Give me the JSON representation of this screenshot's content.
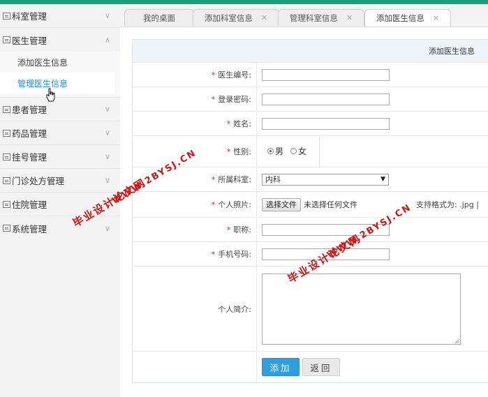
{
  "sidebar": {
    "items": [
      {
        "label": "科室管理",
        "icon": "folder-icon",
        "chevron": "chevron-down-icon"
      },
      {
        "label": "医生管理",
        "icon": "folder-icon",
        "chevron": "chevron-up-icon",
        "children": [
          {
            "label": "添加医生信息"
          },
          {
            "label": "管理医生信息"
          }
        ]
      },
      {
        "label": "患者管理",
        "icon": "folder-icon",
        "chevron": "chevron-down-icon"
      },
      {
        "label": "药品管理",
        "icon": "folder-icon",
        "chevron": "chevron-down-icon"
      },
      {
        "label": "挂号管理",
        "icon": "folder-icon",
        "chevron": "chevron-down-icon"
      },
      {
        "label": "门诊处方管理",
        "icon": "folder-icon",
        "chevron": "chevron-down-icon"
      },
      {
        "label": "住院管理",
        "icon": "folder-icon",
        "chevron": "chevron-down-icon"
      },
      {
        "label": "系统管理",
        "icon": "folder-icon",
        "chevron": "chevron-down-icon"
      }
    ]
  },
  "tabs": [
    {
      "label": "我的桌面",
      "closable": false
    },
    {
      "label": "添加科室信息",
      "closable": true
    },
    {
      "label": "管理科室信息",
      "closable": true
    },
    {
      "label": "添加医生信息",
      "closable": true,
      "active": true
    }
  ],
  "form": {
    "title": "添加医生信息",
    "fields": {
      "doctor_id": {
        "label": "医生编号:",
        "required": "*",
        "value": ""
      },
      "password": {
        "label": "登录密码:",
        "required": "*",
        "value": ""
      },
      "name": {
        "label": "姓名:",
        "required": "*",
        "value": ""
      },
      "gender": {
        "label": "性别:",
        "required": "*",
        "options": [
          "男",
          "女"
        ],
        "selected": "男"
      },
      "department": {
        "label": "所属科室:",
        "required": "*",
        "selected": "内科"
      },
      "photo": {
        "label": "个人照片:",
        "required": "*",
        "button": "选择文件",
        "status": "未选择任何文件",
        "hint": "支持格式为: .jpg |"
      },
      "title": {
        "label": "职称:",
        "required": "*",
        "value": ""
      },
      "phone": {
        "label": "手机号码:",
        "required": "*",
        "value": ""
      },
      "bio": {
        "label": "个人简介:",
        "value": ""
      }
    },
    "buttons": {
      "submit": "添加",
      "back": "返回"
    }
  },
  "watermark": {
    "line1": "毕业设计论文网",
    "line2": "WWW.2BYSJ.CN"
  },
  "colors": {
    "accent": "#1aa07a",
    "primary_button": "#2f9fe0",
    "required": "#e02020",
    "watermark": "#d21414"
  }
}
